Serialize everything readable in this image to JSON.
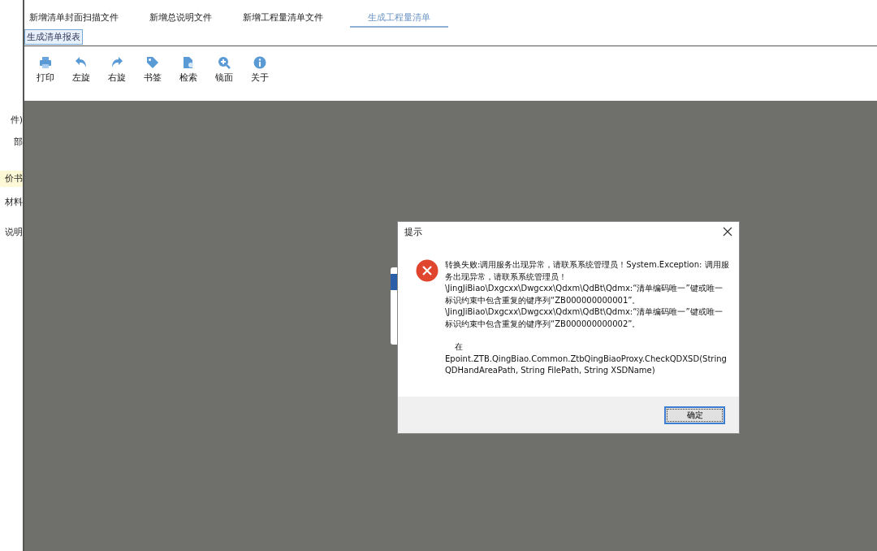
{
  "tabs": [
    {
      "label": "新增清单封面扫描文件",
      "selected": false
    },
    {
      "label": "新增总说明文件",
      "selected": false
    },
    {
      "label": "新增工程量清单文件",
      "selected": false
    },
    {
      "label": "生成工程量清单",
      "selected": true
    }
  ],
  "sub_button": "生成清单报表",
  "toolbar": [
    {
      "kind": "print",
      "label": "打印"
    },
    {
      "kind": "rotate_left",
      "label": "左旋"
    },
    {
      "kind": "rotate_right",
      "label": "右旋"
    },
    {
      "kind": "bookmark",
      "label": "书签"
    },
    {
      "kind": "search_doc",
      "label": "检索"
    },
    {
      "kind": "zoom",
      "label": "镜面"
    },
    {
      "kind": "info",
      "label": "关于"
    }
  ],
  "sidebar": [
    {
      "label": "件)",
      "selected": false
    },
    {
      "label": "部",
      "selected": false
    },
    {
      "label": "价书",
      "selected": true
    },
    {
      "label": "材料",
      "selected": false
    },
    {
      "label": "说明",
      "selected": false
    }
  ],
  "dialog": {
    "title": "提示",
    "message_lines": [
      "转换失败:调用服务出现异常，请联系系统管理员！System.Exception: 调用服",
      "务出现异常，请联系系统管理员！",
      "\\JingJiBiao\\Dxgcxx\\Dwgcxx\\Qdxm\\QdBt\\Qdmx:“清单编码唯一”键或唯一",
      "标识约束中包含重复的键序列“ZB000000000001”。",
      "\\JingJiBiao\\Dxgcxx\\Dwgcxx\\Qdxm\\QdBt\\Qdmx:“清单编码唯一”键或唯一",
      "标识约束中包含重复的键序列“ZB000000000002”。"
    ],
    "trace_lines": [
      "在",
      "Epoint.ZTB.QingBiao.Common.ZtbQingBiaoProxy.CheckQDXSD(String",
      "QDHandAreaPath, String FilePath, String XSDName)"
    ],
    "ok_button": "确定"
  }
}
